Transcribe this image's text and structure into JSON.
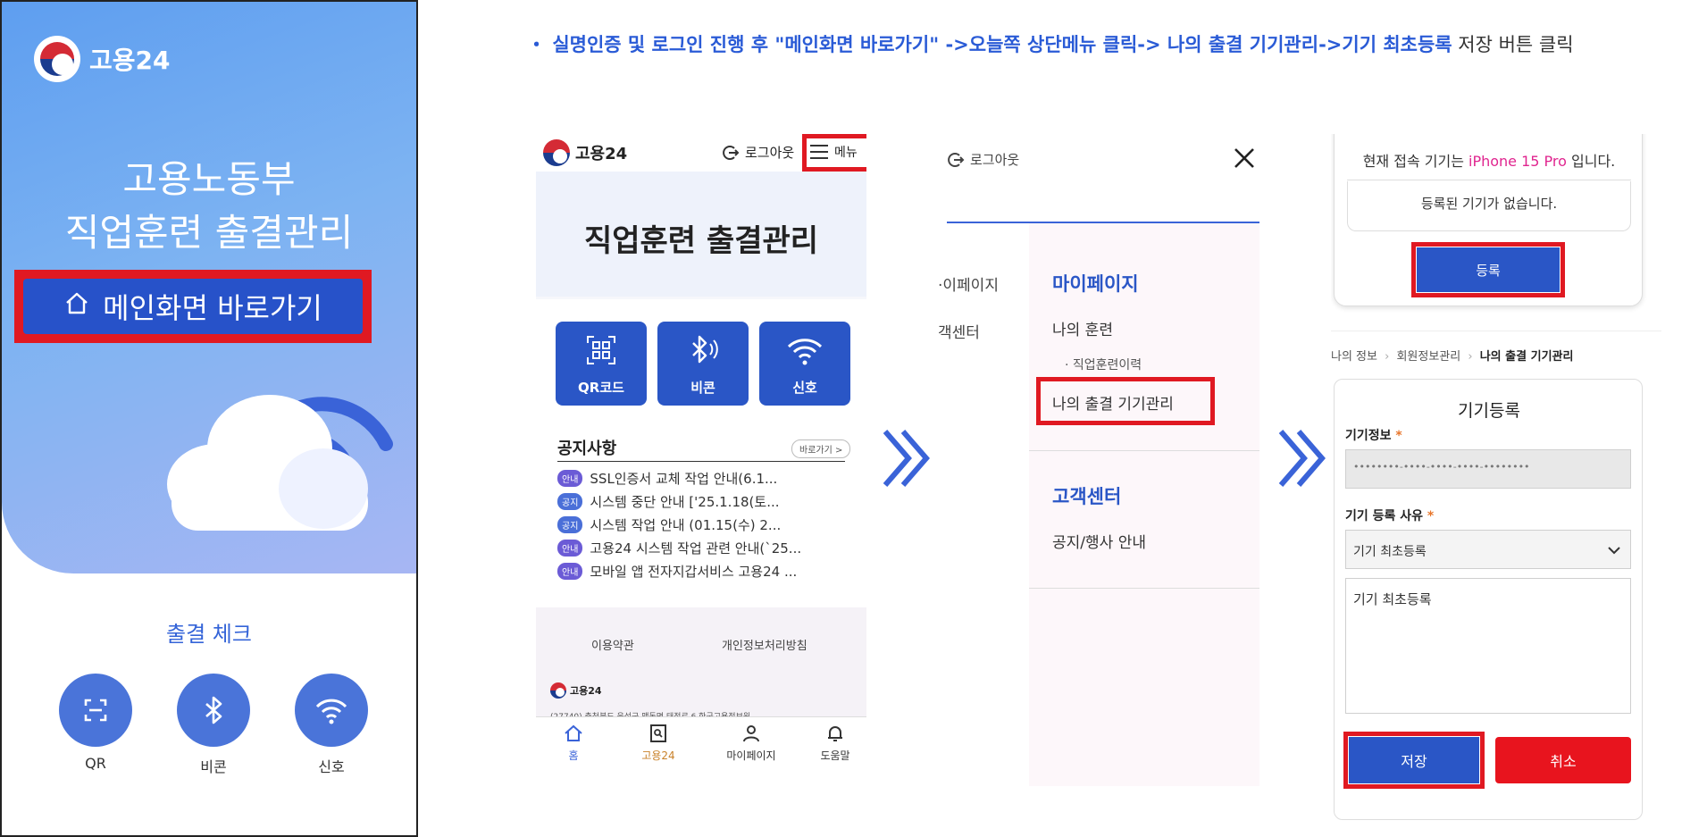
{
  "instruction": {
    "bullet": "・",
    "bold_text": "실명인증 및 로그인 진행 후 \"메인화면 바로가기\" ->오늘쪽 상단메뉴 클릭-> 나의 출결 기기관리->기기 최초등록",
    "plain_text": " 저장 버튼 클릭"
  },
  "app": {
    "logo_text": "고용24",
    "title_line1": "고용노동부",
    "title_line2": "직업훈련 출결관리",
    "main_button_label": "메인화면 바로가기",
    "check_title": "출결 체크",
    "buttons": [
      {
        "label": "QR",
        "icon": "qr-scan-icon"
      },
      {
        "label": "비콘",
        "icon": "bluetooth-icon"
      },
      {
        "label": "신호",
        "icon": "wifi-icon"
      }
    ],
    "colors": {
      "accent": "#2752c9",
      "highlight": "#e01922"
    }
  },
  "shot1": {
    "logo_text": "고용24",
    "logout_label": "로그아웃",
    "menu_label": "메뉴",
    "title": "직업훈련 출결관리",
    "quick_buttons": [
      {
        "label": "QR코드",
        "icon": "qr-code-icon"
      },
      {
        "label": "비콘",
        "icon": "bluetooth-icon"
      },
      {
        "label": "신호",
        "icon": "wifi-icon"
      }
    ],
    "notice_title": "공지사항",
    "notice_more": "바로가기 >",
    "notices": [
      {
        "tag": "안내",
        "text": "SSL인증서 교체 작업 안내(6.1..."
      },
      {
        "tag": "공지",
        "text": "시스템 중단 안내 ['25.1.18(토..."
      },
      {
        "tag": "공지",
        "text": "시스템 작업 안내 (01.15(수) 2..."
      },
      {
        "tag": "안내",
        "text": "고용24 시스템 작업 관련 안내(`25..."
      },
      {
        "tag": "안내",
        "text": "모바일 앱 전자지갑서비스 고용24 ..."
      }
    ],
    "footer_links": [
      "이용약관",
      "개인정보처리방침"
    ],
    "footer_logo": "고용24",
    "footer_address": "(27740) 충청북도 음성군 맹동면 태정로 6 한국고용정보원",
    "tabbar": [
      {
        "label": "홈",
        "icon": "home-icon"
      },
      {
        "label": "고용24",
        "icon": "search-doc-icon"
      },
      {
        "label": "마이페이지",
        "icon": "person-icon"
      },
      {
        "label": "도움말",
        "icon": "bell-icon"
      }
    ]
  },
  "shot2": {
    "logout_label": "로그아웃",
    "left_items": [
      "·이페이지",
      "객센터"
    ],
    "section1": "마이페이지",
    "item1": "나의 훈련",
    "subitem1": "· 직업훈련이력",
    "item2": "나의 출결 기기관리",
    "section2": "고객센터",
    "item3": "공지/행사 안내"
  },
  "shot3": {
    "current_device_prefix": "현재 접속 기기는 ",
    "current_device_name": "iPhone 15 Pro",
    "current_device_suffix": " 입니다.",
    "no_device_text": "등록된 기기가 없습니다.",
    "register_button": "등록",
    "breadcrumb": [
      "나의 정보",
      "회원정보관리",
      "나의 출결 기기관리"
    ],
    "form_title": "기기등록",
    "device_info_label": "기기정보",
    "device_info_value": "••••••••-••••-••••-••••-••••••••",
    "reason_label": "기기 등록 사유",
    "reason_selected": "기기 최초등록",
    "reason_text": "기기 최초등록",
    "save_button": "저장",
    "cancel_button": "취소",
    "colors": {
      "device_name": "#e0258f",
      "save": "#2a56c6",
      "cancel": "#e8141e"
    }
  }
}
